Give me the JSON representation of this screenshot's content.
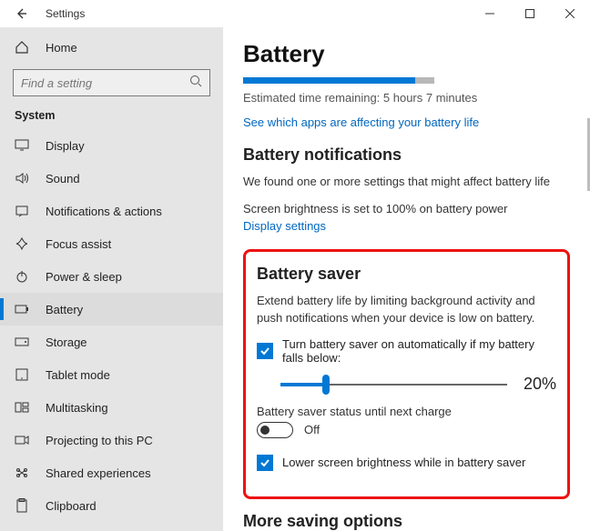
{
  "title": "Settings",
  "search": {
    "placeholder": "Find a setting"
  },
  "sidebar": {
    "home": "Home",
    "section": "System",
    "items": [
      {
        "label": "Display"
      },
      {
        "label": "Sound"
      },
      {
        "label": "Notifications & actions"
      },
      {
        "label": "Focus assist"
      },
      {
        "label": "Power & sleep"
      },
      {
        "label": "Battery"
      },
      {
        "label": "Storage"
      },
      {
        "label": "Tablet mode"
      },
      {
        "label": "Multitasking"
      },
      {
        "label": "Projecting to this PC"
      },
      {
        "label": "Shared experiences"
      },
      {
        "label": "Clipboard"
      }
    ]
  },
  "main": {
    "heading": "Battery",
    "progress_percent": 90,
    "estimated": "Estimated time remaining: 5 hours 7 minutes",
    "apps_link": "See which apps are affecting your battery life",
    "notifications": {
      "title": "Battery notifications",
      "found": "We found one or more settings that might affect battery life",
      "brightness_line": "Screen brightness is set to 100% on battery power",
      "display_link": "Display settings"
    },
    "saver": {
      "title": "Battery saver",
      "desc": "Extend battery life by limiting background activity and push notifications when your device is low on battery.",
      "auto_label": "Turn battery saver on automatically if my battery falls below:",
      "slider_percent": 20,
      "slider_display": "20%",
      "status_label": "Battery saver status until next charge",
      "toggle_state": "Off",
      "lower_brightness_label": "Lower screen brightness while in battery saver"
    },
    "more": "More saving options"
  }
}
